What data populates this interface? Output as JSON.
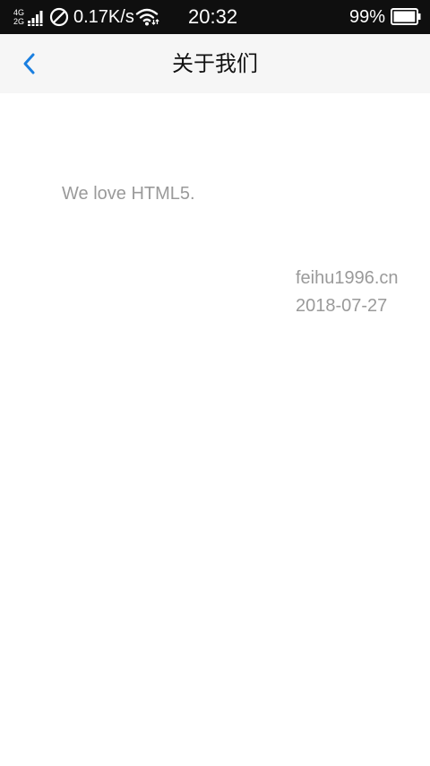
{
  "status_bar": {
    "network_top": "4G",
    "network_bottom": "2G",
    "net_speed": "0.17K/s",
    "time": "20:32",
    "battery_percent": "99%",
    "battery_level": 0.99
  },
  "nav": {
    "title": "关于我们",
    "accent_color": "#1a7fe0"
  },
  "content": {
    "tagline": "We love HTML5.",
    "website": "feihu1996.cn",
    "date": "2018-07-27"
  }
}
